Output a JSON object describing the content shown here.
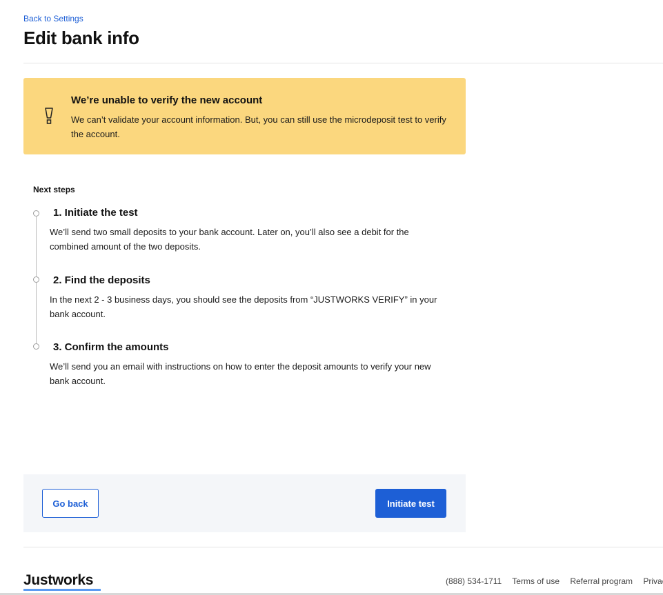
{
  "header": {
    "back_link": "Back to Settings",
    "title": "Edit bank info"
  },
  "alert": {
    "icon": "exclamation-icon",
    "title": "We’re unable to verify the new account",
    "body": "We can’t validate your account information. But, you can still use the microdeposit test to verify the account.",
    "background_color": "#fbd77e"
  },
  "next_steps": {
    "label": "Next steps",
    "steps": [
      {
        "title": "1. Initiate the test",
        "description": "We’ll send two small deposits to your bank account. Later on, you’ll also see a debit for the combined amount of the two deposits."
      },
      {
        "title": "2. Find the deposits",
        "description": "In the next 2 - 3 business days, you should see the deposits from “JUSTWORKS VERIFY” in your bank account."
      },
      {
        "title": "3. Confirm the amounts",
        "description": "We’ll send you an email with instructions on how to enter the deposit amounts to verify your new bank account."
      }
    ]
  },
  "actions": {
    "back_label": "Go back",
    "primary_label": "Initiate test",
    "primary_color": "#1d5fd6"
  },
  "footer": {
    "logo": "Justworks",
    "phone": "(888) 534-1711",
    "links": [
      "Terms of use",
      "Referral program",
      "Privacy"
    ]
  }
}
